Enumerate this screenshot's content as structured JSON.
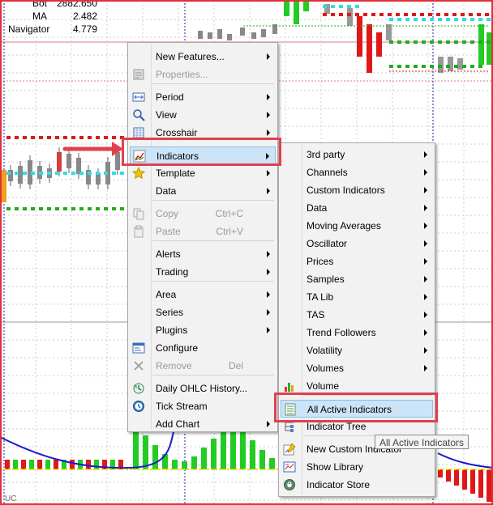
{
  "chart": {
    "legend": [
      {
        "name": "Bot",
        "value": "2882.650"
      },
      {
        "name": "MA",
        "value": "2.482"
      },
      {
        "name": "Navigator",
        "value": "4.779"
      }
    ],
    "bottom_label": "UC"
  },
  "context_menu": {
    "items": [
      {
        "label": "New Features...",
        "submenu": true,
        "disabled": false,
        "icon": ""
      },
      {
        "label": "Properties...",
        "submenu": false,
        "disabled": true,
        "icon": "properties-icon"
      },
      {
        "label": "Period",
        "submenu": true,
        "disabled": false,
        "icon": "period-icon"
      },
      {
        "label": "View",
        "submenu": true,
        "disabled": false,
        "icon": "magnifier-icon"
      },
      {
        "label": "Crosshair",
        "submenu": true,
        "disabled": false,
        "icon": "crosshair-icon"
      },
      {
        "label": "Indicators",
        "submenu": true,
        "disabled": false,
        "icon": "indicators-icon",
        "highlighted": true
      },
      {
        "label": "Template",
        "submenu": true,
        "disabled": false,
        "icon": "star-icon"
      },
      {
        "label": "Data",
        "submenu": true,
        "disabled": false,
        "icon": ""
      },
      {
        "label": "Copy",
        "shortcut": "Ctrl+C",
        "submenu": false,
        "disabled": true,
        "icon": "copy-icon"
      },
      {
        "label": "Paste",
        "shortcut": "Ctrl+V",
        "submenu": false,
        "disabled": true,
        "icon": "paste-icon"
      },
      {
        "label": "Alerts",
        "submenu": true,
        "disabled": false,
        "icon": ""
      },
      {
        "label": "Trading",
        "submenu": true,
        "disabled": false,
        "icon": ""
      },
      {
        "label": "Area",
        "submenu": true,
        "disabled": false,
        "icon": ""
      },
      {
        "label": "Series",
        "submenu": true,
        "disabled": false,
        "icon": ""
      },
      {
        "label": "Plugins",
        "submenu": true,
        "disabled": false,
        "icon": ""
      },
      {
        "label": "Configure",
        "submenu": false,
        "disabled": false,
        "icon": "configure-icon"
      },
      {
        "label": "Remove",
        "shortcut": "Del",
        "submenu": false,
        "disabled": true,
        "icon": "remove-icon"
      },
      {
        "label": "Daily OHLC History...",
        "submenu": false,
        "disabled": false,
        "icon": "history-icon"
      },
      {
        "label": "Tick Stream",
        "submenu": false,
        "disabled": false,
        "icon": "clock-icon"
      },
      {
        "label": "Add Chart",
        "submenu": true,
        "disabled": false,
        "icon": ""
      }
    ]
  },
  "indicators_submenu": {
    "items": [
      {
        "label": "3rd party",
        "submenu": true,
        "icon": ""
      },
      {
        "label": "Channels",
        "submenu": true,
        "icon": ""
      },
      {
        "label": "Custom Indicators",
        "submenu": true,
        "icon": ""
      },
      {
        "label": "Data",
        "submenu": true,
        "icon": ""
      },
      {
        "label": "Moving Averages",
        "submenu": true,
        "icon": ""
      },
      {
        "label": "Oscillator",
        "submenu": true,
        "icon": ""
      },
      {
        "label": "Prices",
        "submenu": true,
        "icon": ""
      },
      {
        "label": "Samples",
        "submenu": true,
        "icon": ""
      },
      {
        "label": "TA Lib",
        "submenu": true,
        "icon": ""
      },
      {
        "label": "TAS",
        "submenu": true,
        "icon": ""
      },
      {
        "label": "Trend Followers",
        "submenu": true,
        "icon": ""
      },
      {
        "label": "Volatility",
        "submenu": true,
        "icon": ""
      },
      {
        "label": "Volumes",
        "submenu": true,
        "icon": ""
      },
      {
        "label": "Volume",
        "submenu": false,
        "icon": "volume-icon"
      },
      {
        "label": "All Active Indicators",
        "submenu": false,
        "icon": "active-indicators-icon",
        "highlighted": true
      },
      {
        "label": "Indicator Tree",
        "submenu": false,
        "icon": "tree-icon"
      },
      {
        "label": "New Custom Indicator",
        "submenu": false,
        "icon": "new-indicator-icon"
      },
      {
        "label": "Show Library",
        "submenu": false,
        "icon": "library-icon"
      },
      {
        "label": "Indicator Store",
        "submenu": false,
        "icon": "store-icon"
      }
    ]
  },
  "tooltip": "All Active Indicators",
  "colors": {
    "up_candle": "#888888",
    "bull_bar": "#22cc22",
    "bear_bar": "#e01818",
    "grid": "#cfcfcf",
    "ma_line": "#1a1ad0",
    "highlight": "#cce4f7",
    "annotation": "#e04050"
  }
}
